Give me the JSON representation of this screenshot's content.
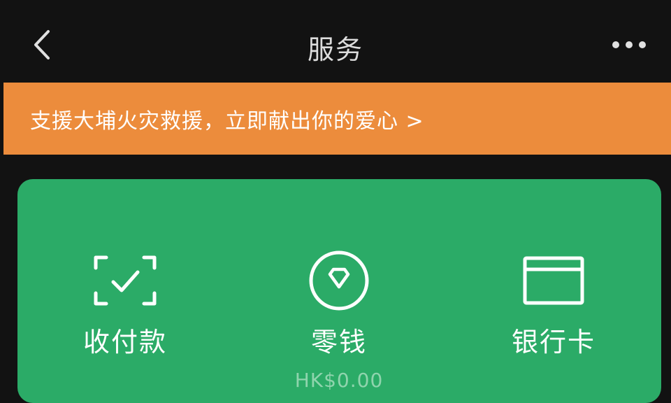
{
  "header": {
    "title": "服务",
    "back_icon": "chevron-left-icon",
    "more_icon": "more-horizontal-icon"
  },
  "banner": {
    "text": "支援大埔火灾救援，立即献出你的爱心 >",
    "background_color": "#ec8c3c"
  },
  "wallet_card": {
    "background_color": "#2bab67",
    "items": [
      {
        "label": "收付款",
        "icon": "scan-check-icon"
      },
      {
        "label": "零钱",
        "icon": "diamond-coin-icon",
        "sub": "HK$0.00"
      },
      {
        "label": "银行卡",
        "icon": "bank-card-icon"
      }
    ]
  }
}
